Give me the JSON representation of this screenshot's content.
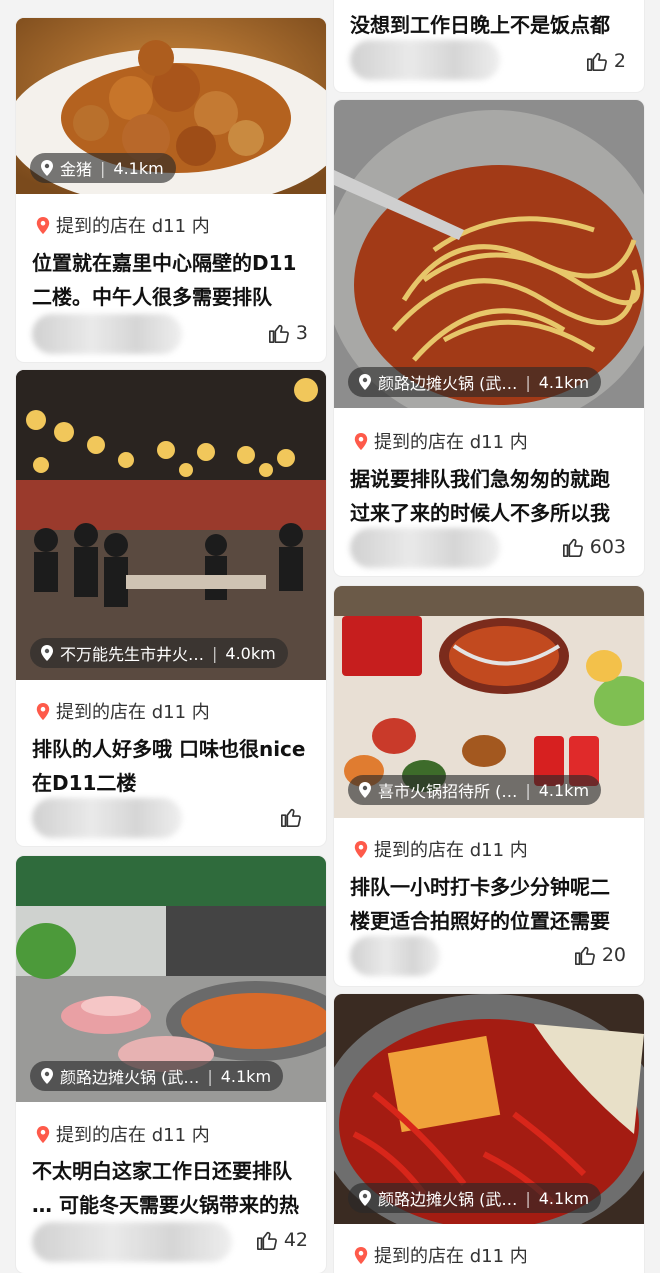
{
  "cards": [
    {
      "id": "c1",
      "location": "金猪",
      "distance": "4.1km",
      "mention": "提到的店在 d11 内",
      "text_lines": [
        "位置就在嘉里中心隔壁的D11",
        "二楼。中午人很多需要排队"
      ],
      "likes": "3"
    },
    {
      "id": "c2",
      "location": "不万能先生市井火…",
      "distance": "4.0km",
      "mention": "提到的店在 d11 内",
      "text_lines": [
        "排队的人好多哦 口味也很nice",
        "在D11二楼"
      ],
      "likes": ""
    },
    {
      "id": "c3",
      "location": "颜路边摊火锅 (武…",
      "distance": "4.1km",
      "mention": "提到的店在 d11 内",
      "text_lines": [
        "不太明白这家工作日还要排队",
        "… 可能冬天需要火锅带来的热"
      ],
      "likes": "42"
    },
    {
      "id": "c4",
      "text_lines": [
        "没想到工作日晚上不是饭点都"
      ],
      "likes": "2"
    },
    {
      "id": "c5",
      "location": "颜路边摊火锅 (武…",
      "distance": "4.1km",
      "mention": "提到的店在 d11 内",
      "text_lines": [
        "据说要排队我们急匆匆的就跑",
        "过来了来的时候人不多所以我"
      ],
      "likes": "603"
    },
    {
      "id": "c6",
      "location": "喜市火锅招待所 (…",
      "distance": "4.1km",
      "mention": "提到的店在 d11 内",
      "text_lines": [
        "排队一小时打卡多少分钟呢二",
        "楼更适合拍照好的位置还需要"
      ],
      "likes": "20"
    },
    {
      "id": "c7",
      "location": "颜路边摊火锅 (武…",
      "distance": "4.1km",
      "mention": "提到的店在 d11 内"
    }
  ],
  "icons": {
    "pin": "location-pin-icon",
    "like": "thumbs-up-icon"
  },
  "colors": {
    "accent": "#fe5a4a",
    "text": "#111111",
    "pill_bg": "#3a3a3a"
  }
}
